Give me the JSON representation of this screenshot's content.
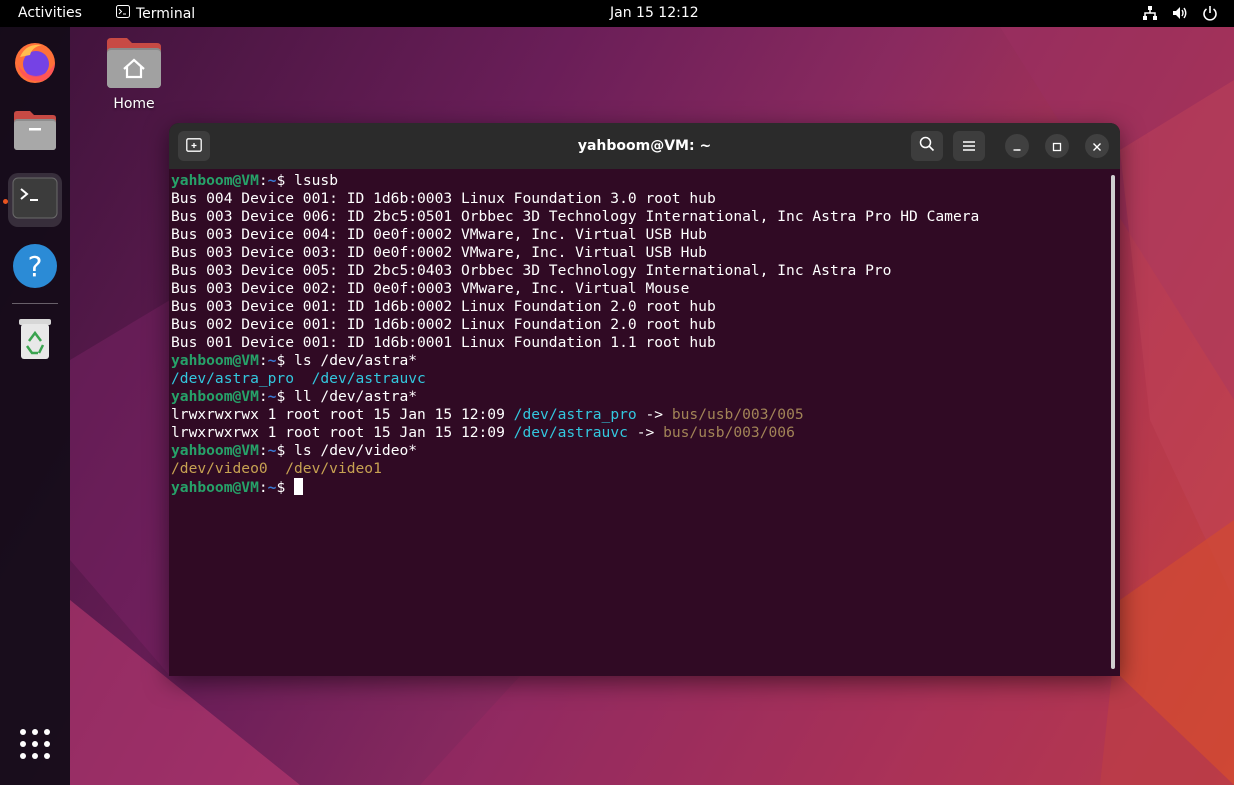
{
  "topbar": {
    "activities": "Activities",
    "app_name": "Terminal",
    "clock": "Jan 15  12:12"
  },
  "desktop": {
    "home_label": "Home"
  },
  "terminal": {
    "title": "yahboom@VM: ~",
    "prompt_user": "yahboom@VM",
    "prompt_sep": ":",
    "prompt_path": "~",
    "prompt_dollar": "$ ",
    "commands": {
      "c1": "lsusb",
      "c2": "ls /dev/astra*",
      "c3": "ll /dev/astra*",
      "c4": "ls /dev/video*"
    },
    "lsusb_output": [
      "Bus 004 Device 001: ID 1d6b:0003 Linux Foundation 3.0 root hub",
      "Bus 003 Device 006: ID 2bc5:0501 Orbbec 3D Technology International, Inc Astra Pro HD Camera",
      "Bus 003 Device 004: ID 0e0f:0002 VMware, Inc. Virtual USB Hub",
      "Bus 003 Device 003: ID 0e0f:0002 VMware, Inc. Virtual USB Hub",
      "Bus 003 Device 005: ID 2bc5:0403 Orbbec 3D Technology International, Inc Astra Pro",
      "Bus 003 Device 002: ID 0e0f:0003 VMware, Inc. Virtual Mouse",
      "Bus 003 Device 001: ID 1d6b:0002 Linux Foundation 2.0 root hub",
      "Bus 002 Device 001: ID 1d6b:0002 Linux Foundation 2.0 root hub",
      "Bus 001 Device 001: ID 1d6b:0001 Linux Foundation 1.1 root hub"
    ],
    "ls_astra": {
      "a": "/dev/astra_pro",
      "gap": "  ",
      "b": "/dev/astrauvc"
    },
    "ll_astra": [
      {
        "prefix": "lrwxrwxrwx 1 root root 15 Jan 15 12:09 ",
        "link": "/dev/astra_pro",
        "arrow": " -> ",
        "target": "bus/usb/003/005"
      },
      {
        "prefix": "lrwxrwxrwx 1 root root 15 Jan 15 12:09 ",
        "link": "/dev/astrauvc",
        "arrow": " -> ",
        "target": "bus/usb/003/006"
      }
    ],
    "ls_video": {
      "a": "/dev/video0",
      "gap": "  ",
      "b": "/dev/video1"
    }
  },
  "icons": {
    "dock": [
      "firefox-icon",
      "files-icon",
      "terminal-icon",
      "help-icon",
      "trash-icon",
      "app-grid-icon"
    ],
    "tray": [
      "network-icon",
      "volume-icon",
      "power-icon"
    ]
  }
}
